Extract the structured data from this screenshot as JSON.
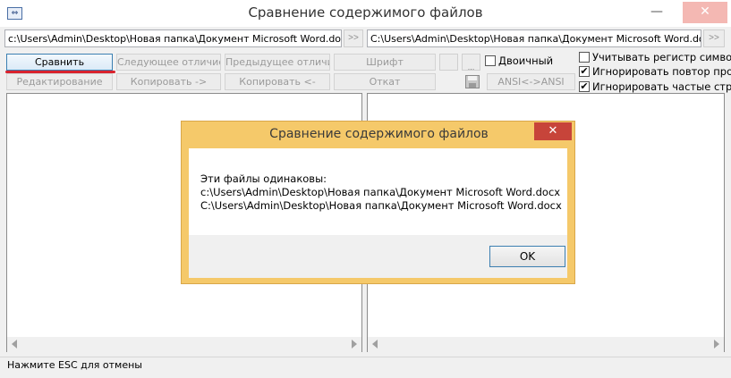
{
  "window": {
    "title": "Сравнение содержимого файлов",
    "app_icon": "⇔",
    "minimize": "—",
    "close": "✕"
  },
  "paths": {
    "left": "c:\\Users\\Admin\\Desktop\\Новая папка\\Документ Microsoft Word.docx",
    "right": "C:\\Users\\Admin\\Desktop\\Новая папка\\Документ Microsoft Word.docx",
    "browse_label": ">>"
  },
  "toolbar": {
    "compare": "Сравнить",
    "next_diff": "Следующее отличие",
    "prev_diff": "Предыдущее отличие",
    "font": "Шрифт",
    "edit": "Редактирование",
    "copy_right": "Копировать ->",
    "copy_left": "Копировать <-",
    "revert": "Откат",
    "encoding": "ANSI<->ANSI",
    "ellipsis": "..."
  },
  "options": {
    "binary": {
      "label": "Двоичный",
      "checked": false
    },
    "case_sensitive": {
      "label": "Учитывать регистр символов",
      "checked": false
    },
    "ignore_spaces": {
      "label": "Игнорировать повтор пробелов",
      "checked": true
    },
    "ignore_frequent": {
      "label": "Игнорировать частые строки",
      "checked": true
    }
  },
  "status": {
    "text": "Нажмите ESC для отмены"
  },
  "dialog": {
    "title": "Сравнение содержимого файлов",
    "close": "✕",
    "message": "Эти файлы одинаковы:",
    "file1": "c:\\Users\\Admin\\Desktop\\Новая папка\\Документ Microsoft Word.docx",
    "file2": "C:\\Users\\Admin\\Desktop\\Новая папка\\Документ Microsoft Word.docx",
    "ok": "OK"
  },
  "colors": {
    "accent_underline": "#d9232e",
    "dialog_frame": "#f5c96a",
    "close_button": "#c7443a"
  }
}
